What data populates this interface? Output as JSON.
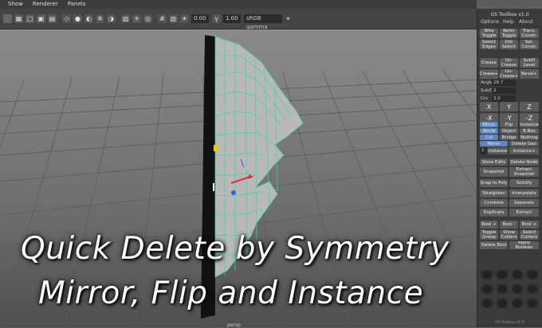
{
  "app": {
    "menus": [
      "Show",
      "Renderer",
      "Panels"
    ]
  },
  "toolbar": {
    "field1": "0.00",
    "field2": "1.00",
    "colorspace": "sRGB gamma"
  },
  "viewport": {
    "camera": "persp"
  },
  "toolbox": {
    "title": "GS Toolbox v1.0",
    "tabs": [
      "Options",
      "Help",
      "About"
    ],
    "row1": [
      "Wire Toggle",
      "Refer Toggle",
      "Trans. Constr."
    ],
    "row2": [
      "Select Edges",
      "Dot Select",
      "Sel. Constr."
    ],
    "row3": [
      "Crease",
      "Un-Crease",
      "SubD Level"
    ],
    "row4": [
      "Crease+",
      "Un-Crease+",
      "Bevel+"
    ],
    "angle_label": "Angle",
    "angle_value": "28.7",
    "subd_label": "SubD",
    "subd_value": "2",
    "crs_label": "Crs",
    "crs_value": "3.0",
    "axes": [
      "X",
      "Y",
      "Z",
      "-X",
      "-Y",
      "-Z"
    ],
    "sym_row1": [
      "Mirror",
      "Flip",
      "Instance"
    ],
    "sym_row2": [
      "World",
      "Object",
      "B.Box"
    ],
    "sym_row3": [
      "Cut",
      "Bridge",
      "Nothing"
    ],
    "sym_row4": [
      "Mirror",
      "Delete Geo"
    ],
    "instance_count": "1",
    "instance_label": "Instance",
    "instance_plus": "Instance+",
    "store_edits": "Store Edits",
    "delete_node": "Delete Node",
    "snapshot": "Snapshot",
    "extract_snapshot": "Extract Snapshot",
    "snap_to_poly": "Snap to Poly",
    "solidify": "Solidify",
    "straighten": "Straighten",
    "interpolate": "Interpolate",
    "combine": "Combine",
    "separate": "Separate",
    "duplicate": "Duplicate",
    "extract": "Extract",
    "bool_add": "Bool +",
    "bool_sub": "Bool -",
    "bool_plus": "Bool +",
    "toggle_group": "Toggle Group",
    "show_cutters": "Show Cutters",
    "select_cutters": "Select Cutters",
    "delete_bool": "Delete Bool",
    "apply_boolean": "Apply Boolean",
    "footer": "GS Toolbox v1.0"
  },
  "caption": {
    "line1": "Quick Delete by Symmetry",
    "line2": "Mirror, Flip and Instance"
  }
}
